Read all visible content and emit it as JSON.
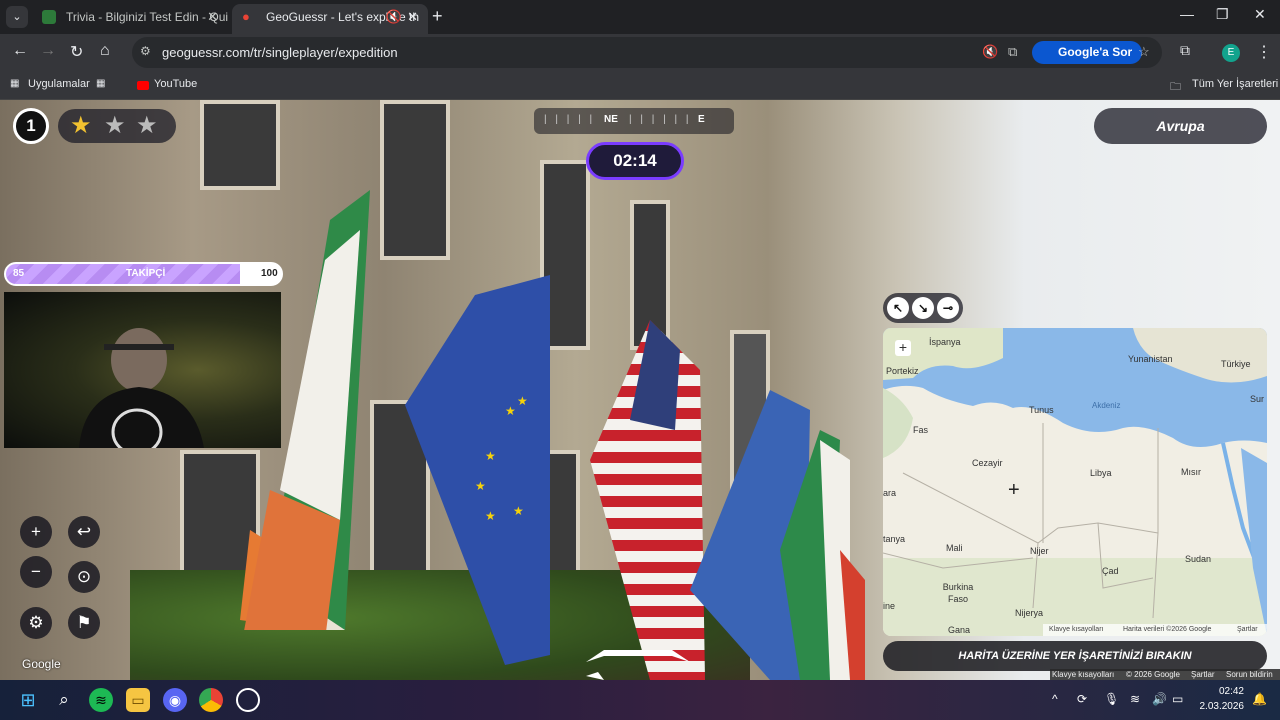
{
  "browser": {
    "tabs": [
      {
        "title": "Trivia - Bilginizi Test Edin - Quiz",
        "active": false
      },
      {
        "title": "GeoGuessr - Let's explore th",
        "active": true
      }
    ],
    "url": "geoguessr.com/tr/singleplayer/expedition",
    "ask_google": "Google'a Sor",
    "profile_initial": "E",
    "bookmarks": {
      "apps": "Uygulamalar",
      "youtube": "YouTube",
      "all_bookmarks": "Tüm Yer İşaretleri"
    }
  },
  "game": {
    "round": "1",
    "stars_filled": 1,
    "stars_total": 3,
    "compass": {
      "label_ne": "NE",
      "label_e": "E"
    },
    "timer": "02:14",
    "region_button": "Avrupa",
    "follower_bar": {
      "min": "85",
      "label": "TAKİPÇİ",
      "max": "100",
      "progress": 0.85
    },
    "google_watermark": "Google",
    "place_marker_button": "HARİTA ÜZERİNE YER İŞARETİNİZİ BIRAKIN",
    "footer_links": [
      "Klavye kısayolları",
      "© 2026 Google",
      "Şartlar",
      "Sorun bildirin"
    ]
  },
  "minimap": {
    "labels": [
      "İspanya",
      "Portekiz",
      "Yunanistan",
      "Türkiye",
      "Tunus",
      "Akdeniz",
      "Sur",
      "Fas",
      "Cezayir",
      "Libya",
      "Mısır",
      "ara",
      "tanya",
      "Mali",
      "Nijer",
      "Çad",
      "Sudan",
      "Burkina Faso",
      "ine",
      "Nijerya",
      "Gana"
    ],
    "attribution": [
      "Klavye kısayolları",
      "Harita verileri ©2026 Google",
      "Şartlar"
    ]
  },
  "taskbar": {
    "time": "02:42",
    "date": "2.03.2026"
  },
  "colors": {
    "accent_purple": "#7a3cff",
    "timer_bg": "#1f1b3a",
    "follower_bar": "#c9a3ff"
  }
}
